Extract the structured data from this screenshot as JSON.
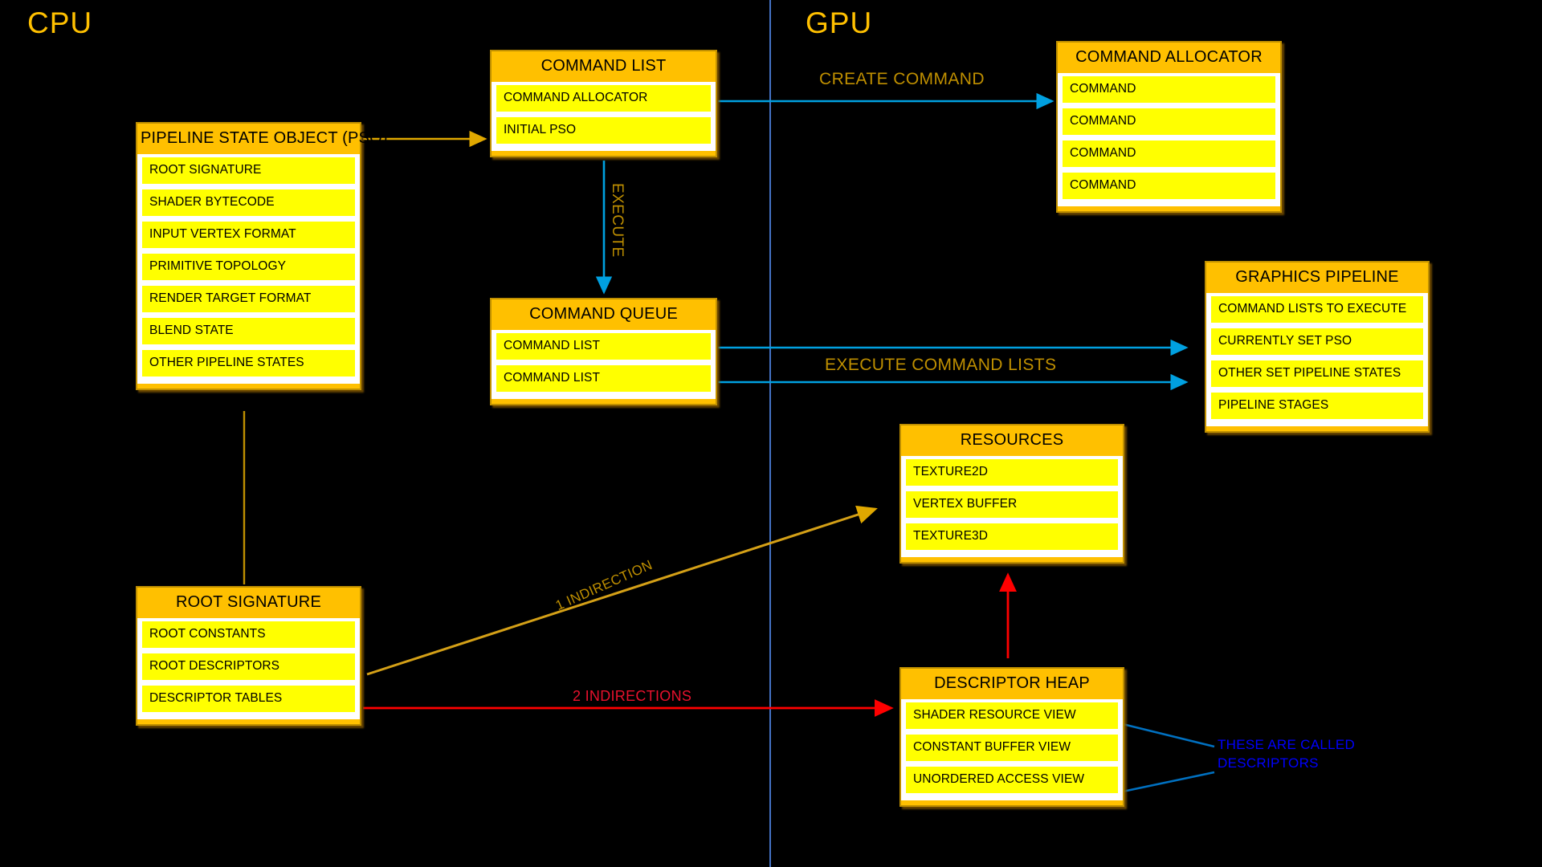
{
  "zones": {
    "cpu": "CPU",
    "gpu": "GPU"
  },
  "colors": {
    "background": "#000000",
    "node_header": "#FFC000",
    "node_row": "#FFFF00",
    "node_border": "#BF8F00",
    "divider": "#4472C4",
    "arrow_blue": "#00A0E0",
    "arrow_gold": "#E0A800",
    "arrow_red": "#FF0000",
    "annotation_blue": "#0000FF",
    "label_gold": "#BF8F00",
    "label_red": "#E8112D"
  },
  "nodes": {
    "pso": {
      "title": "PIPELINE STATE OBJECT (PSO)",
      "rows": [
        "ROOT SIGNATURE",
        "SHADER BYTECODE",
        "INPUT VERTEX FORMAT",
        "PRIMITIVE TOPOLOGY",
        "RENDER TARGET FORMAT",
        "BLEND STATE",
        "OTHER PIPELINE STATES"
      ]
    },
    "command_list": {
      "title": "COMMAND LIST",
      "rows": [
        "COMMAND ALLOCATOR",
        "INITIAL PSO"
      ]
    },
    "command_allocator": {
      "title": "COMMAND ALLOCATOR",
      "rows": [
        "COMMAND",
        "COMMAND",
        "COMMAND",
        "COMMAND"
      ]
    },
    "command_queue": {
      "title": "COMMAND QUEUE",
      "rows": [
        "COMMAND LIST",
        "COMMAND LIST"
      ]
    },
    "graphics_pipeline": {
      "title": "GRAPHICS PIPELINE",
      "rows": [
        "COMMAND LISTS TO EXECUTE",
        "CURRENTLY SET PSO",
        "OTHER SET PIPELINE STATES",
        "PIPELINE STAGES"
      ]
    },
    "resources": {
      "title": "RESOURCES",
      "rows": [
        "TEXTURE2D",
        "VERTEX BUFFER",
        "TEXTURE3D"
      ]
    },
    "root_signature": {
      "title": "ROOT SIGNATURE",
      "rows": [
        "ROOT CONSTANTS",
        "ROOT DESCRIPTORS",
        "DESCRIPTOR TABLES"
      ]
    },
    "descriptor_heap": {
      "title": "DESCRIPTOR HEAP",
      "rows": [
        "SHADER RESOURCE VIEW",
        "CONSTANT BUFFER VIEW",
        "UNORDERED ACCESS VIEW"
      ]
    }
  },
  "edge_labels": {
    "create_command": "CREATE COMMAND",
    "execute": "EXECUTE",
    "execute_command_lists": "EXECUTE COMMAND LISTS",
    "one_indirection": "1 INDIRECTION",
    "two_indirections": "2 INDIRECTIONS",
    "these_are_called_descriptors": "THESE ARE CALLED DESCRIPTORS"
  }
}
